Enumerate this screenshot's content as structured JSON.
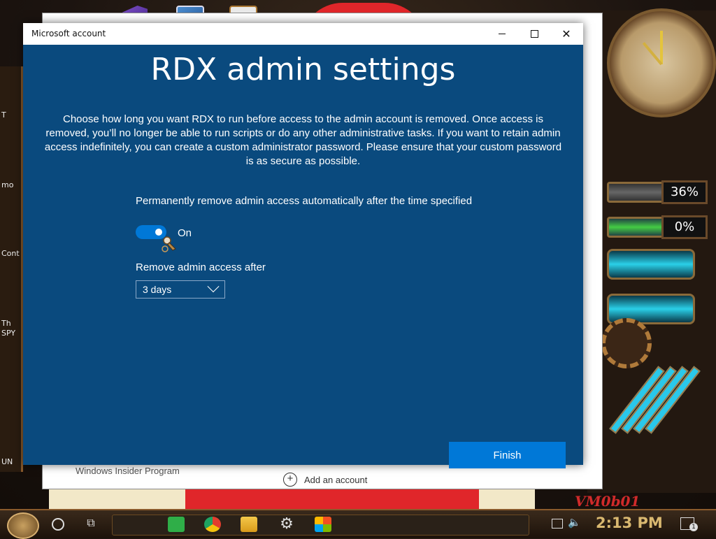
{
  "window": {
    "title": "Microsoft account",
    "minimize_glyph": "—",
    "maximize_glyph": "☐",
    "close_glyph": "✕"
  },
  "dialog": {
    "heading": "RDX admin settings",
    "description": "Choose how long you want RDX to run before access to the admin account is removed. Once access is removed, you’ll no longer be able to run scripts or do any other administrative tasks. If you want to retain admin access indefinitely, you can create a custom administrator password. Please ensure that your custom password is as secure as possible.",
    "toggle_label": "Permanently remove admin access automatically after the time specified",
    "toggle_state": "On",
    "toggle_on": true,
    "remove_label": "Remove admin access after",
    "dropdown_value": "3 days",
    "finish_label": "Finish"
  },
  "background": {
    "behind_window_item": "Windows Insider Program",
    "behind_add_account": "Add an account",
    "gauge_1": "36%",
    "gauge_2": "0%",
    "watermark": "VM0b01",
    "left_labels": [
      "T",
      "mo",
      "Cont",
      "Th SPY",
      "UN"
    ]
  },
  "taskbar": {
    "time": "2:13 PM",
    "notification_count": "1"
  }
}
